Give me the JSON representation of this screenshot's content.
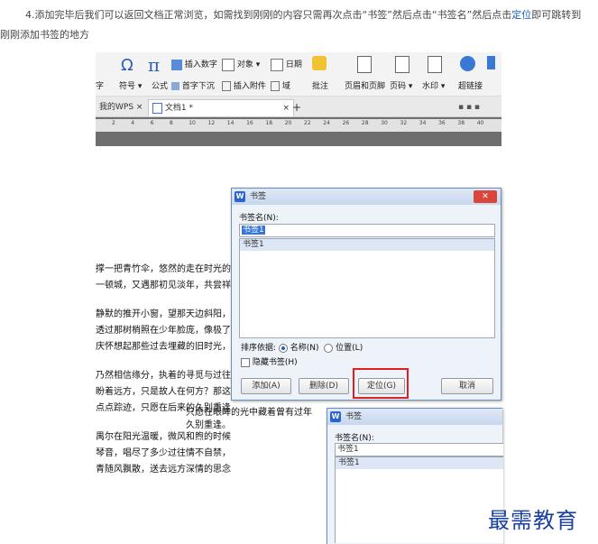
{
  "intro": {
    "line1": "4.添加完毕后我们可以返回文档正常浏览，如需找到刚刚的内容只需再次点击“书签”然后点击“书签名”然后点击",
    "link": "定位",
    "line1_end": "即可跳转到",
    "line2": "刚刚添加书签的地方"
  },
  "ribbon": {
    "omega": "Ω",
    "pi": "π",
    "insert_number": "插入数字",
    "object": "对象",
    "date": "日期",
    "char_label": "字",
    "symbol": "符号",
    "formula": "公式",
    "drop_cap": "首字下沉",
    "insert_attachment": "插入附件",
    "field": "域",
    "comment": "批注",
    "header_footer": "页眉和页脚",
    "page_number": "页码",
    "watermark": "水印",
    "hyperlink": "超链接"
  },
  "tabs": {
    "my_wps": "我的WPS",
    "doc1": "文档1 *",
    "add": "+"
  },
  "ruler": {
    "ticks": [
      "2",
      "4",
      "6",
      "8",
      "10",
      "12",
      "14",
      "16",
      "18",
      "20",
      "22",
      "24",
      "26",
      "28",
      "30",
      "32",
      "34",
      "36",
      "38",
      "40"
    ]
  },
  "document": {
    "lines": [
      "撑一把青竹伞，悠然的走在时光的",
      "一顿城，又遇那初见淡年，共尝祥",
      "",
      "静默的推开小窗，望那天边斜阳，",
      "透过那树梢照在少年脸庞，像极了",
      "庆怀想起那些过去埋藏的旧时光，",
      "",
      "乃然相信缘分，执着的寻觅与过往",
      "盼着远方，只是故人在何方？那这",
      "点点踪迹，只愿在后来的久别重逢",
      "",
      "禺尔在阳光温暖，微风和煦的时候",
      "琴音，唱尽了多少过往情不自禁，",
      "青随风飘散，送去远方深情的思念"
    ],
    "tail1": "只愿在眼眸的光中藏着曾有过年",
    "tail2": "久别重逢。"
  },
  "dialog_main": {
    "title": "书签",
    "name_label": "书签名(N):",
    "name_value": "书签1",
    "list_items": [
      "书签1"
    ],
    "sort_label": "排序依据:",
    "sort_name": "名称(N)",
    "sort_position": "位置(L)",
    "hide_label": "隐藏书签(H)",
    "add_button": "添加(A)",
    "delete_button": "删除(D)",
    "goto_button": "定位(G)",
    "cancel_button": "取消"
  },
  "dialog_second": {
    "title": "书签",
    "name_label": "书签名(N):",
    "name_value": "书签1",
    "list_items": [
      "书签1"
    ]
  },
  "watermark": "最需教育",
  "colors": {
    "link": "#1a5fc8",
    "highlight": "#e02020",
    "dialog_border": "#6c8ebf"
  }
}
